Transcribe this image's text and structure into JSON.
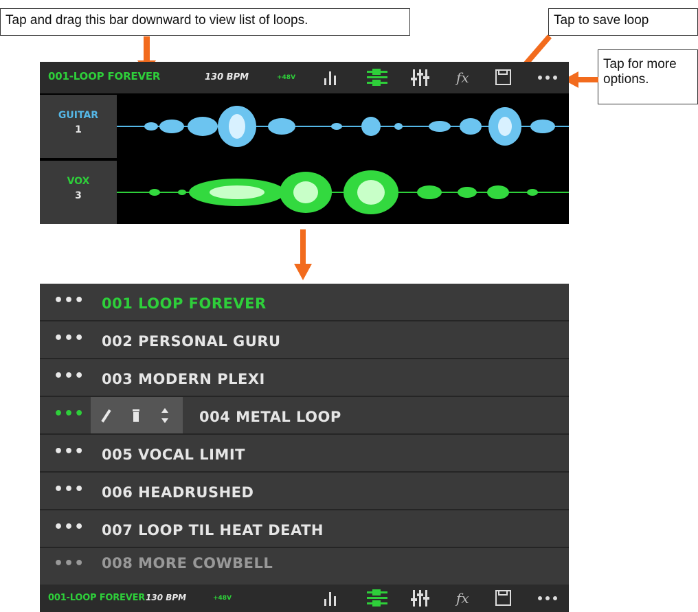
{
  "callouts": {
    "drag_bar": "Tap and drag this bar downward to view list of loops.",
    "save_loop": "Tap to save loop",
    "more_options": "Tap for more options."
  },
  "colors": {
    "arrow": "#f26b1d",
    "active_green": "#2ecf3a",
    "guitar_blue": "#55b8e8",
    "vox_green": "#2ecf3a",
    "bar_bg": "#2b2b2b",
    "row_bg": "#3a3a3a"
  },
  "top_bar": {
    "loop_name": "001-LOOP FOREVER",
    "bpm": "130 BPM",
    "phantom": "+48V",
    "icons": [
      "levels-icon",
      "tracks-icon",
      "mixer-icon",
      "fx-icon",
      "save-icon",
      "more-icon"
    ]
  },
  "tracks": [
    {
      "name": "GUITAR",
      "number": "1",
      "color": "#55b8e8"
    },
    {
      "name": "VOX",
      "number": "3",
      "color": "#2ecf3a"
    }
  ],
  "loop_list": {
    "items": [
      {
        "label": "001 LOOP FOREVER",
        "active": true
      },
      {
        "label": "002 PERSONAL GURU",
        "active": false
      },
      {
        "label": "003 MODERN PLEXI",
        "active": false
      },
      {
        "label": "004 METAL LOOP",
        "active": false,
        "editing": true
      },
      {
        "label": "005 VOCAL LIMIT",
        "active": false
      },
      {
        "label": "006 HEADRUSHED",
        "active": false
      },
      {
        "label": "007 LOOP TIL HEAT DEATH",
        "active": false
      },
      {
        "label": "008 MORE COWBELL",
        "active": false
      }
    ],
    "more_symbol": "•••"
  },
  "bottom_bar": {
    "loop_name": "001-LOOP FOREVER",
    "bpm": "130 BPM",
    "phantom": "+48V"
  }
}
